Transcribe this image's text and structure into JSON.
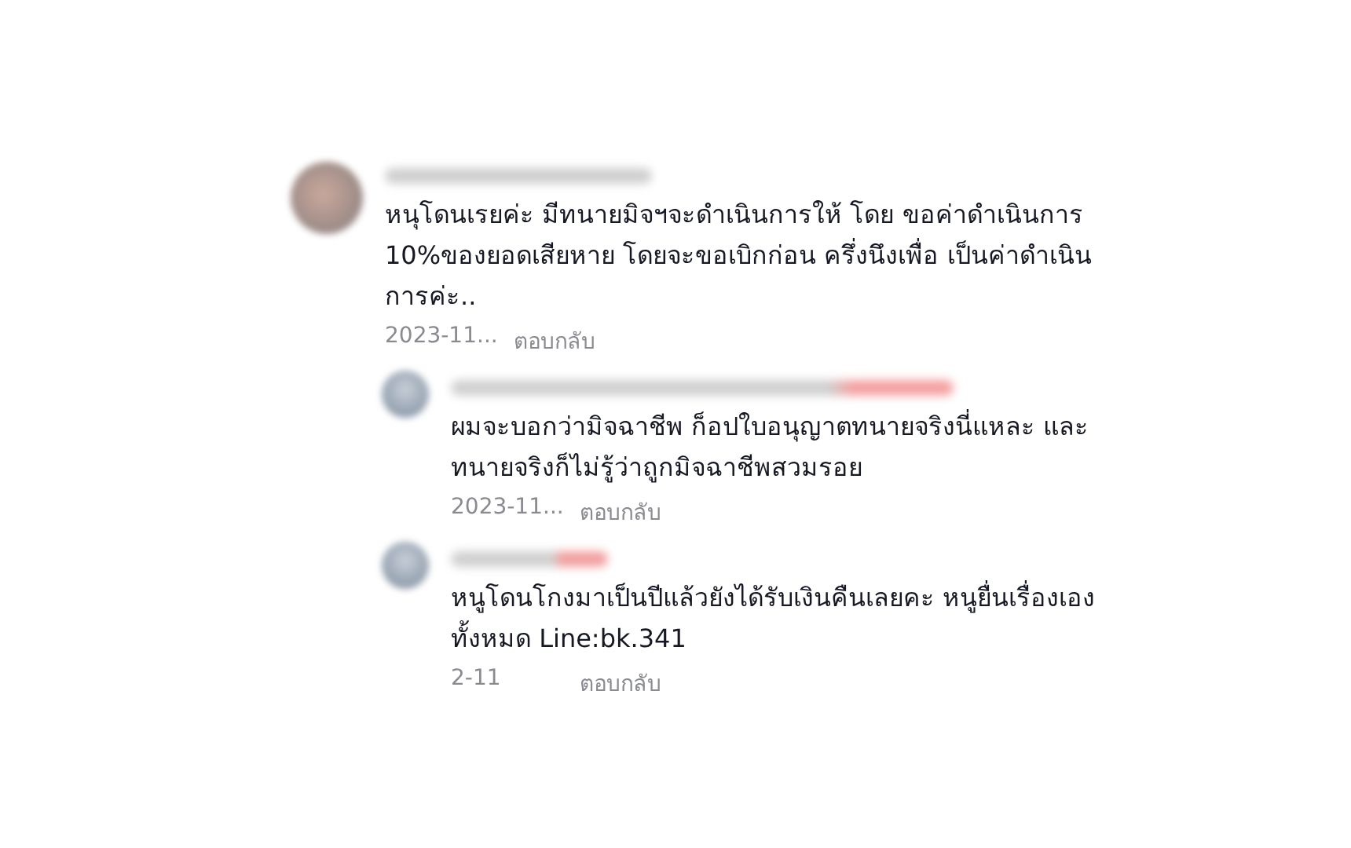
{
  "comments": [
    {
      "text": "หนุโดนเรยค่ะ มีทนายมิจฯจะดำเนินการให้ โดย ขอค่าดำเนินการ 10%ของยอดเสียหาย โดยจะขอเบิกก่อน ครึ่งนึงเพื่อ เป็นค่าดำเนินการค่ะ..",
      "date": "2023-11...",
      "reply": "ตอบกลับ",
      "replies": [
        {
          "text": "ผมจะบอกว่ามิจฉาชีพ ก็อปใบอนุญาตทนายจริงนี่แหละ และทนายจริงก็ไม่รู้ว่าถูกมิจฉาชีพสวมรอย",
          "date": "2023-11...",
          "reply": "ตอบกลับ"
        },
        {
          "text": "หนูโดนโกงมาเป็นปีแล้วยังได้รับเงินคืนเลยคะ หนูยื่นเรื่องเองทั้งหมด Line:bk.341",
          "date": "2-11",
          "reply": "ตอบกลับ"
        }
      ]
    }
  ]
}
